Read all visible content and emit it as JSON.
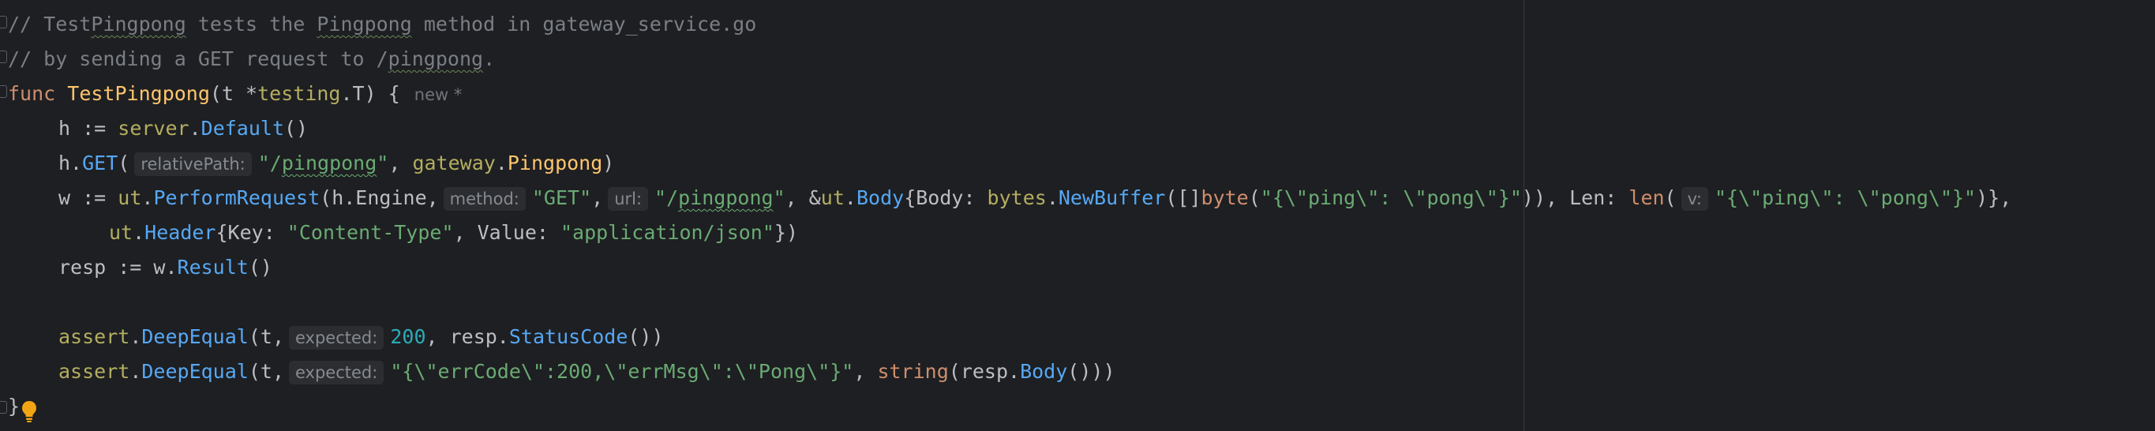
{
  "editor": {
    "lines": {
      "l1": {
        "slash": "// ",
        "w1": "Test",
        "w2": "Pingpong",
        "w3": " tests the ",
        "w4": "Pingpong",
        "w5": " method in gateway_service.go"
      },
      "l2": {
        "w1": "// by sending a GET request to /",
        "w2": "pingpong",
        "w3": "."
      },
      "l3": {
        "kw": "func",
        "name": "TestPingpong",
        "p1": "(t *",
        "pkg": "testing",
        "dot": ".",
        "type": "T",
        "p2": ") {",
        "hint": "new *"
      },
      "l4": {
        "lhs": "h := ",
        "pkg": "server",
        "dot": ".",
        "call": "Default",
        "rest": "()"
      },
      "l5": {
        "recv": "h.",
        "call": "GET",
        "open": "(",
        "hint": "relativePath:",
        "str_q1": "\"/",
        "str_word": "pingpong",
        "str_q2": "\"",
        "comma": ", ",
        "pkg": "gateway",
        "dot": ".",
        "fn": "Pingpong",
        "close": ")"
      },
      "l6": {
        "lhs": "w := ",
        "pkg": "ut",
        "dot1": ".",
        "call": "PerformRequest",
        "args1": "(h.Engine,",
        "hint_method": "method:",
        "str_get": "\"GET\"",
        "c1": ",",
        "hint_url": "url:",
        "str_q1": "\"/",
        "str_word": "pingpong",
        "str_q2": "\"",
        "c2": ", &",
        "pkg2": "ut",
        "dot2": ".",
        "type_body": "Body",
        "brace1": "{Body: ",
        "pkg3": "bytes",
        "dot3": ".",
        "call2": "NewBuffer",
        "slice": "([]",
        "builtin_byte": "byte",
        "open2": "(",
        "str_json": "\"{\\\"ping\\\": \\\"pong\\\"}\"",
        "close2": ")), Len: ",
        "builtin_len": "len",
        "open3": "(",
        "hint_v": "v:",
        "str_json2": "\"{\\\"ping\\\": \\\"pong\\\"}\"",
        "close3": ")},"
      },
      "l7": {
        "pkg": "ut",
        "dot": ".",
        "type": "Header",
        "brace": "{Key: ",
        "str_key": "\"Content-Type\"",
        "mid": ", Value: ",
        "str_val": "\"application/json\"",
        "close": "})"
      },
      "l8": {
        "lhs": "resp := w.",
        "call": "Result",
        "rest": "()"
      },
      "l10": {
        "pkg": "assert",
        "dot": ".",
        "call": "DeepEqual",
        "args": "(t,",
        "hint": "expected:",
        "num": "200",
        "mid": ", resp.",
        "field": "StatusCode",
        "rest": "())"
      },
      "l11": {
        "pkg": "assert",
        "dot": ".",
        "call": "DeepEqual",
        "args": "(t,",
        "hint": "expected:",
        "str": "\"{\\\"errCode\\\":200,\\\"errMsg\\\":\\\"Pong\\\"}\"",
        "mid": ", ",
        "builtin": "string",
        "rest1": "(resp.",
        "call2": "Body",
        "rest2": "()))"
      },
      "l12": {
        "brace": "}"
      }
    }
  },
  "colors": {
    "background": "#1e1f22",
    "comment": "#7a7e85",
    "keyword": "#cf8e6d",
    "function_decl": "#ffc66d",
    "string": "#6aab73",
    "number": "#2aacb8",
    "inlay_hint_bg": "#2b2d30",
    "inlay_hint_text": "#868a91",
    "bulb": "#f2a514"
  },
  "icons": {
    "intention_bulb": "lightbulb-icon"
  }
}
